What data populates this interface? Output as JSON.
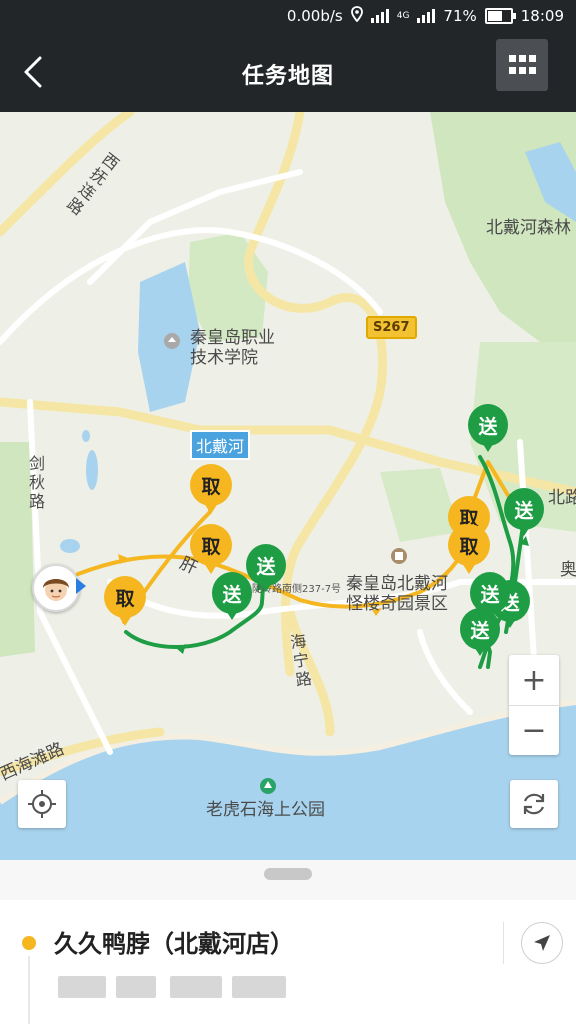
{
  "status_bar": {
    "speed": "0.00b/s",
    "network": "4G",
    "battery": "71%",
    "battery_level": 0.71,
    "time": "18:09"
  },
  "nav": {
    "title": "任务地图"
  },
  "map": {
    "labels": {
      "road_xifu": "西抚连路",
      "forest": "北戴河森林",
      "school_l1": "秦皇岛职业",
      "school_l2": "技术学院",
      "route": "S267",
      "river": "北戴河",
      "road_jianqiu": "剑秋路",
      "road_shan": "肝",
      "addr": "陡岭路南侧237-7号",
      "scenic_l1": "秦皇岛北戴河",
      "scenic_l2": "怪楼奇园景区",
      "road_haining": "海宁路",
      "road_xihaitan": "西海滩路",
      "park": "老虎石海上公园",
      "road_beilu": "北路",
      "road_ao": "奥"
    },
    "markers": {
      "pickup": "取",
      "deliver": "送"
    },
    "controls": {
      "zoom_in": "+",
      "zoom_out": "−"
    }
  },
  "order": {
    "store_name": "久久鸭脖（北戴河店）"
  },
  "colors": {
    "pickup": "#f5b620",
    "deliver": "#1e9d45",
    "header": "#222629",
    "water": "#a8d3ee"
  }
}
